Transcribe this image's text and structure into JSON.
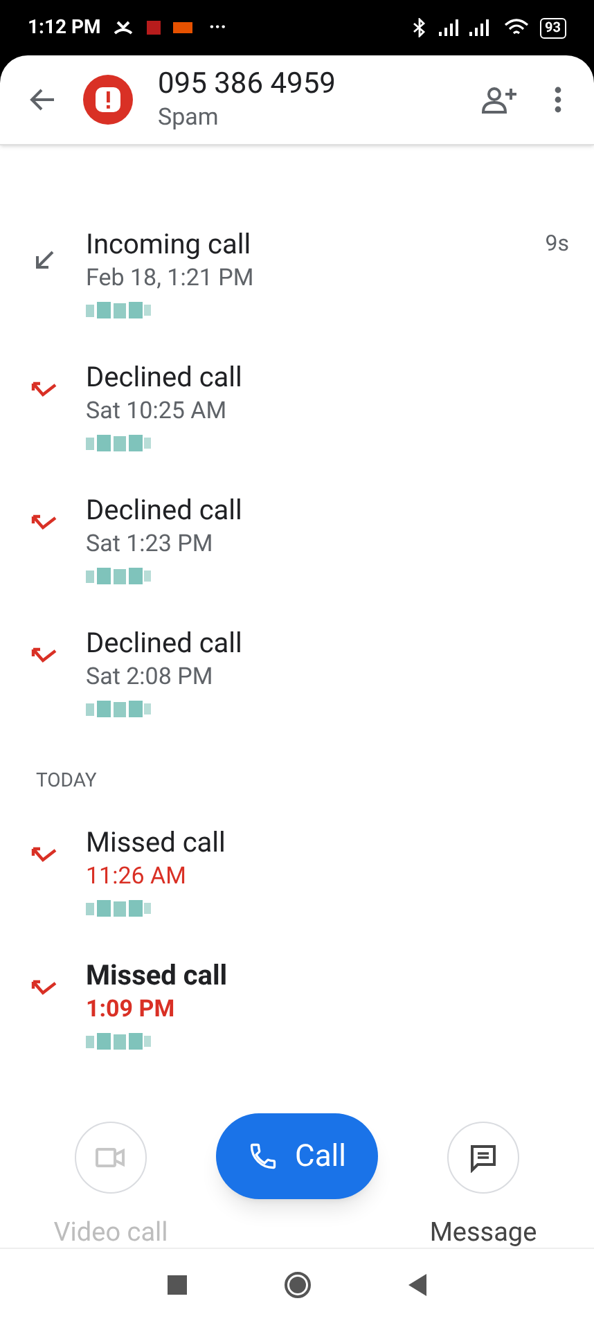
{
  "status_bar": {
    "time": "1:12 PM",
    "more": "···",
    "battery": "93"
  },
  "header": {
    "number": "095 386 4959",
    "label": "Spam"
  },
  "sections": [
    {
      "calls": [
        {
          "kind": "incoming",
          "title": "Incoming call",
          "time": "Feb 18, 1:21 PM",
          "duration": "9s",
          "unread": false
        },
        {
          "kind": "declined",
          "title": "Declined call",
          "time": "Sat 10:25 AM",
          "unread": false
        },
        {
          "kind": "declined",
          "title": "Declined call",
          "time": "Sat 1:23 PM",
          "unread": false
        },
        {
          "kind": "declined",
          "title": "Declined call",
          "time": "Sat 2:08 PM",
          "unread": false
        }
      ]
    },
    {
      "heading": "TODAY",
      "calls": [
        {
          "kind": "missed",
          "title": "Missed call",
          "time": "11:26 AM",
          "unread": false
        },
        {
          "kind": "missed",
          "title": "Missed call",
          "time": "1:09 PM",
          "unread": true
        }
      ]
    }
  ],
  "actions": [
    {
      "kind": "video",
      "label": "Video call",
      "disabled": true
    },
    {
      "kind": "call",
      "label": "Call",
      "disabled": false
    },
    {
      "kind": "message",
      "label": "Message",
      "disabled": false
    }
  ]
}
